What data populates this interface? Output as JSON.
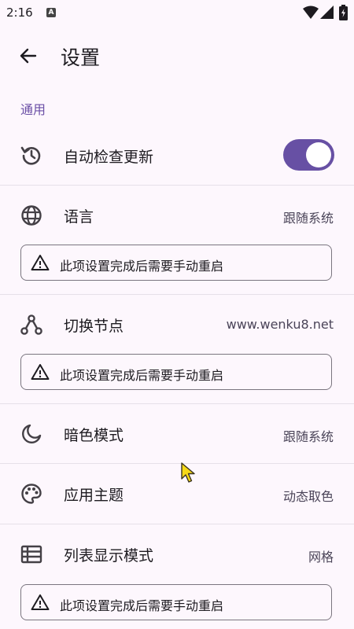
{
  "status_bar": {
    "time": "2:16",
    "notification_badge": "A"
  },
  "app_bar": {
    "title": "设置"
  },
  "section": {
    "general_label": "通用"
  },
  "settings": {
    "auto_update": {
      "label": "自动检查更新",
      "enabled": true
    },
    "language": {
      "label": "语言",
      "value": "跟随系统"
    },
    "node": {
      "label": "切换节点",
      "value": "www.wenku8.net"
    },
    "dark_mode": {
      "label": "暗色模式",
      "value": "跟随系统"
    },
    "theme": {
      "label": "应用主题",
      "value": "动态取色"
    },
    "list_mode": {
      "label": "列表显示模式",
      "value": "网格"
    }
  },
  "notice": {
    "restart_text": "此项设置完成后需要手动重启"
  },
  "colors": {
    "accent": "#6750a4",
    "background": "#fdf7fd",
    "section_label": "#6b4fa6"
  }
}
